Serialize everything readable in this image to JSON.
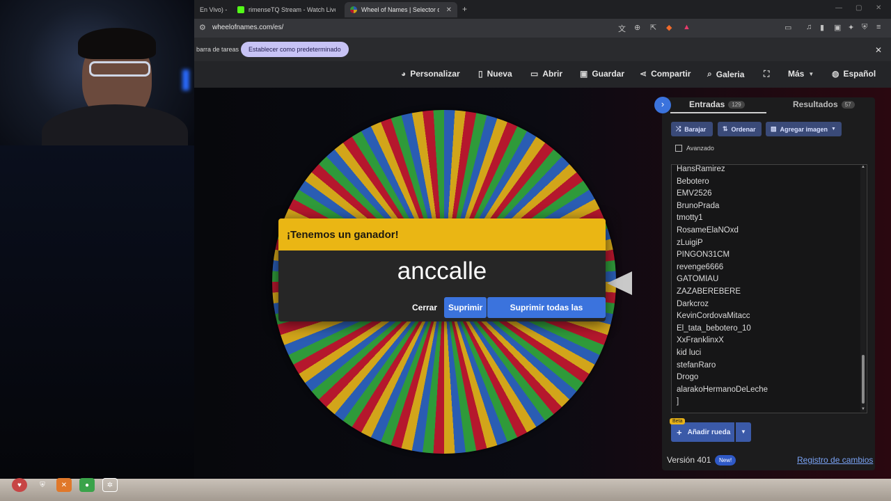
{
  "browser": {
    "tabs": [
      {
        "title": "En Vivo) - "
      },
      {
        "title": "rimenseTQ Stream - Watch Live on K"
      },
      {
        "title": "Wheel of Names | Selector de no"
      }
    ],
    "new_tab": "+",
    "url": "wheelofnames.com/es/"
  },
  "infobar": {
    "text": "barra de tareas",
    "button": "Establecer como predeterminado",
    "close": "✕"
  },
  "nav": {
    "customize": "Personalizar",
    "new": "Nueva",
    "open": "Abrir",
    "save": "Guardar",
    "share": "Compartir",
    "gallery": "Galeria",
    "more": "Más",
    "language": "Español"
  },
  "dialog": {
    "title": "¡Tenemos un ganador!",
    "winner": "anccalle",
    "close": "Cerrar",
    "remove": "Suprimir",
    "remove_all": "Suprimir todas las instancias"
  },
  "panel": {
    "entries_tab": "Entradas",
    "entries_count": "129",
    "results_tab": "Resultados",
    "results_count": "57",
    "shuffle": "Barajar",
    "sort": "Ordenar",
    "add_image": "Agregar imagen",
    "advanced": "Avanzado",
    "entries": [
      "HansRamirez",
      "Bebotero",
      "EMV2526",
      "BrunoPrada",
      "tmotty1",
      "RosameElaNOxd",
      "zLuigiP",
      "PINGON31CM",
      "revenge6666",
      "GATOMIAU",
      "ZAZABEREBERE",
      "Darkcroz",
      "KevinCordovaMitacc",
      "El_tata_bebotero_10",
      "XxFranklinxX",
      "kid luci",
      "stefanRaro",
      "Drogo",
      "alarakoHermanoDeLeche",
      "]"
    ],
    "beta": "Beta",
    "add_wheel": "Añadir rueda",
    "version": "Versión 401",
    "new_badge": "New!",
    "changelog": "Registro de cambios"
  },
  "colors": {
    "wheel": [
      "#2a5db3",
      "#d2a51a",
      "#b5172d",
      "#2f9a3a"
    ],
    "dialog_header": "#eab614",
    "accent": "#3b73dd"
  }
}
